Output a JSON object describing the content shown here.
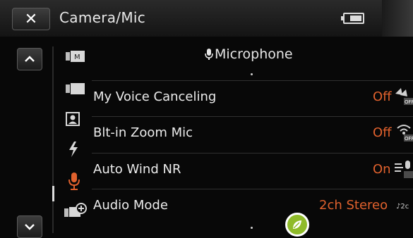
{
  "header": {
    "close_icon": "close-icon",
    "title": "Camera/Mic",
    "battery_icon": "battery-icon"
  },
  "nav": {
    "up_icon": "chevron-up-icon",
    "down_icon": "chevron-down-icon",
    "side_icons": [
      "movie-mode-icon",
      "camera-icon",
      "portrait-icon",
      "flash-icon",
      "microphone-icon",
      "add-icon"
    ]
  },
  "section": {
    "icon": "microphone-icon",
    "title": "Microphone"
  },
  "rows": [
    {
      "label": "My Voice Canceling",
      "value": "Off",
      "icon": "voice-canceling-off-icon"
    },
    {
      "label": "Blt-in Zoom Mic",
      "value": "Off",
      "icon": "zoom-mic-off-icon"
    },
    {
      "label": "Auto Wind NR",
      "value": "On",
      "icon": "wind-nr-icon"
    },
    {
      "label": "Audio Mode",
      "value": "2ch Stereo",
      "icon": "audio-mode-icon"
    }
  ],
  "colors": {
    "accent_orange": "#e0612d",
    "cursor_green": "#8fbb2a"
  }
}
